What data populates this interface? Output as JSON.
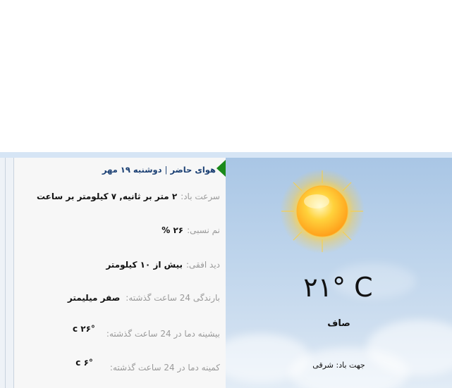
{
  "header": {
    "title": "هوای حاضر",
    "separator": "|",
    "date": "دوشنبه ۱۹ مهر"
  },
  "details": [
    {
      "label": "سرعت باد:",
      "value": "۲ متر بر ثانیه, ۷ کیلومتر بر ساعت"
    },
    {
      "label": "نم نسبی:",
      "value": "۲۶ %"
    },
    {
      "label": "دید افقی:",
      "value": "بیش از ۱۰ کیلومتر"
    },
    {
      "label": "بارندگی 24 ساعت گذشته:",
      "value": "صفر میلیمتر"
    },
    {
      "label": "بیشینه دما در 24 ساعت گذشته:",
      "value": "۲۶° c"
    },
    {
      "label": "کمینه دما در 24 ساعت گذشته:",
      "value": "۶° c"
    }
  ],
  "current": {
    "temperature": "۲۱° C",
    "condition": "صاف",
    "wind_direction": "جهت باد: شرقی",
    "icon": "sun-icon"
  },
  "colors": {
    "header_text": "#1a3f73",
    "accent_arrow": "#1b8a1b",
    "label": "#9a9a9a",
    "value": "#111111"
  }
}
